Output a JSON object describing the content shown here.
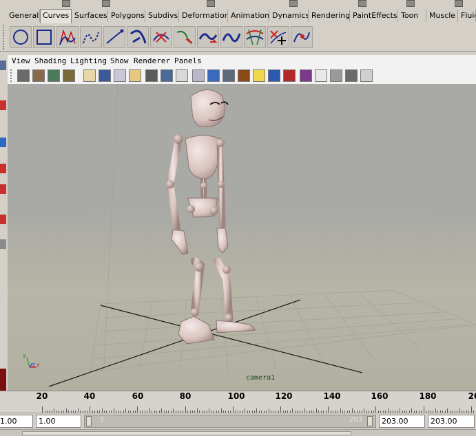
{
  "colors": {
    "viewport_bg": "#a9a9a6",
    "floor": "#b5b3a4",
    "grid": "#9c9a8e",
    "skeleton": "#dcc7c3",
    "camera_label": "#1f4b1f"
  },
  "shelf": {
    "tabs": [
      "General",
      "Curves",
      "Surfaces",
      "Polygons",
      "Subdivs",
      "Deformation",
      "Animation",
      "Dynamics",
      "Rendering",
      "PaintEffects",
      "Toon",
      "Muscle",
      "Fluid"
    ],
    "active_tab": "Curves",
    "icons": [
      "circle-curve-icon",
      "square-curve-icon",
      "cv-curve-icon",
      "ep-curve-icon",
      "pencil-curve-icon",
      "arc-curve-icon",
      "cut-curve-icon",
      "attach-curve-icon",
      "rebuild-curve-icon",
      "smooth-curve-icon",
      "offset-curve-icon",
      "insert-knot-icon",
      "extend-curve-icon"
    ]
  },
  "panel": {
    "menu": [
      "View",
      "Shading",
      "Lighting",
      "Show",
      "Renderer",
      "Panels"
    ]
  },
  "viewport": {
    "camera_label": "camera1",
    "axis_labels": {
      "x": "x",
      "y": "y",
      "z": "z"
    }
  },
  "time_slider": {
    "ticks": [
      "20",
      "40",
      "60",
      "80",
      "100",
      "120",
      "140",
      "160",
      "180",
      "20"
    ]
  },
  "range_slider": {
    "start_time": "1.00",
    "playback_start": "1.00",
    "range_start_ghost": "1",
    "range_end_ghost": "203",
    "playback_end": "203.00",
    "end_time": "203.00"
  }
}
